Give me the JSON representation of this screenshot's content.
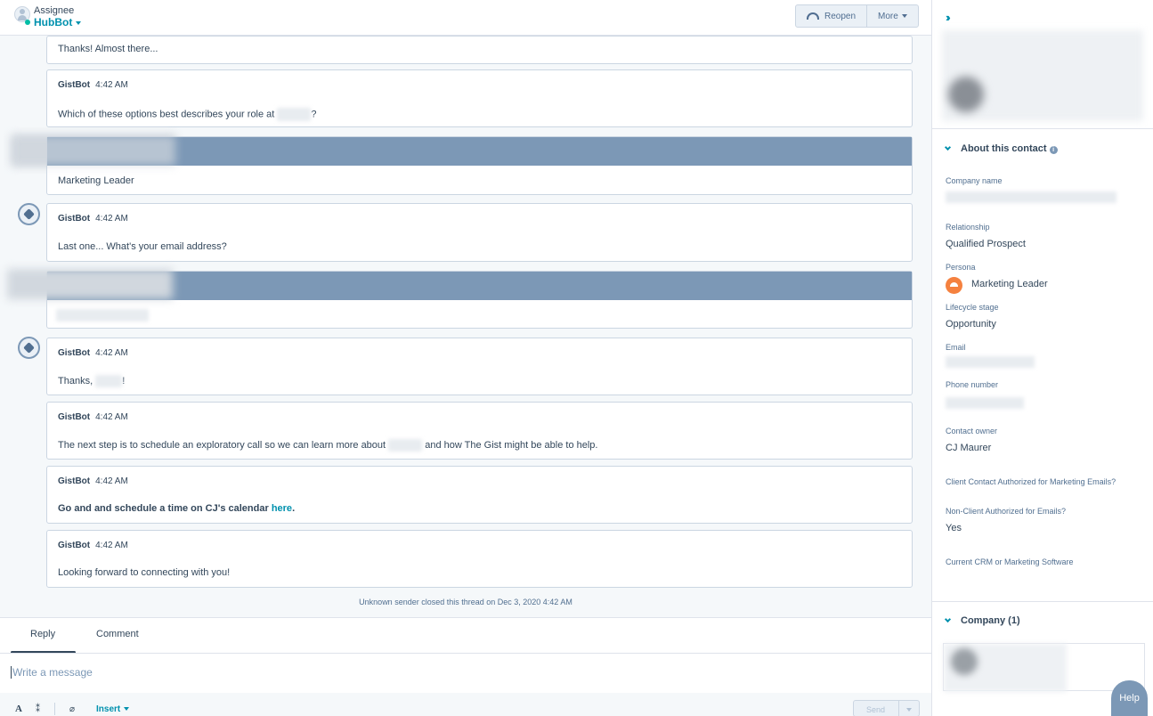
{
  "header": {
    "assignee_label": "Assignee",
    "assignee_name": "HubBot",
    "reopen_label": "Reopen",
    "more_label": "More"
  },
  "thread": {
    "messages": [
      {
        "sender": "",
        "time": "",
        "text": "Thanks! Almost there..."
      },
      {
        "sender": "GistBot",
        "time": "4:42 AM",
        "text_before": "Which of these options best describes your role at",
        "text_after": "?"
      },
      {
        "sender": "",
        "time": "",
        "text": "Marketing Leader"
      },
      {
        "sender": "GistBot",
        "time": "4:42 AM",
        "text": "Last one... What's your email address?"
      },
      {
        "sender": "",
        "time": "",
        "text": ""
      },
      {
        "sender": "GistBot",
        "time": "4:42 AM",
        "text_before": "Thanks,",
        "text_after": "!"
      },
      {
        "sender": "GistBot",
        "time": "4:42 AM",
        "text_before": "The next step is to schedule an exploratory call so we can learn more about",
        "text_after": "and how The Gist might be able to help."
      },
      {
        "sender": "GistBot",
        "time": "4:42 AM",
        "text_before": "Go and and schedule a time on CJ's calendar",
        "link": "here",
        "text_after": "."
      },
      {
        "sender": "GistBot",
        "time": "4:42 AM",
        "text": "Looking forward to connecting with you!"
      }
    ],
    "closed_note": "Unknown sender closed this thread on Dec 3, 2020 4:42 AM"
  },
  "reply": {
    "tabs": [
      "Reply",
      "Comment"
    ],
    "placeholder": "Write a message",
    "insert_label": "Insert",
    "send_label": "Send"
  },
  "sidebar": {
    "about_title": "About this contact",
    "properties": [
      {
        "label": "Company name",
        "value": ""
      },
      {
        "label": "Relationship",
        "value": "Qualified Prospect"
      },
      {
        "label": "Persona",
        "value": "Marketing Leader"
      },
      {
        "label": "Lifecycle stage",
        "value": "Opportunity"
      },
      {
        "label": "Email",
        "value": ""
      },
      {
        "label": "Phone number",
        "value": ""
      },
      {
        "label": "Contact owner",
        "value": "CJ Maurer"
      },
      {
        "label": "Client Contact Authorized for Marketing Emails?",
        "value": ""
      },
      {
        "label": "Non-Client Authorized for Emails?",
        "value": "Yes"
      },
      {
        "label": "Current CRM or Marketing Software",
        "value": ""
      }
    ],
    "company_title": "Company (1)"
  },
  "help_label": "Help",
  "colors": {
    "accent": "#0091ae",
    "visitor_band": "#7c98b6",
    "persona": "#f5813f"
  }
}
